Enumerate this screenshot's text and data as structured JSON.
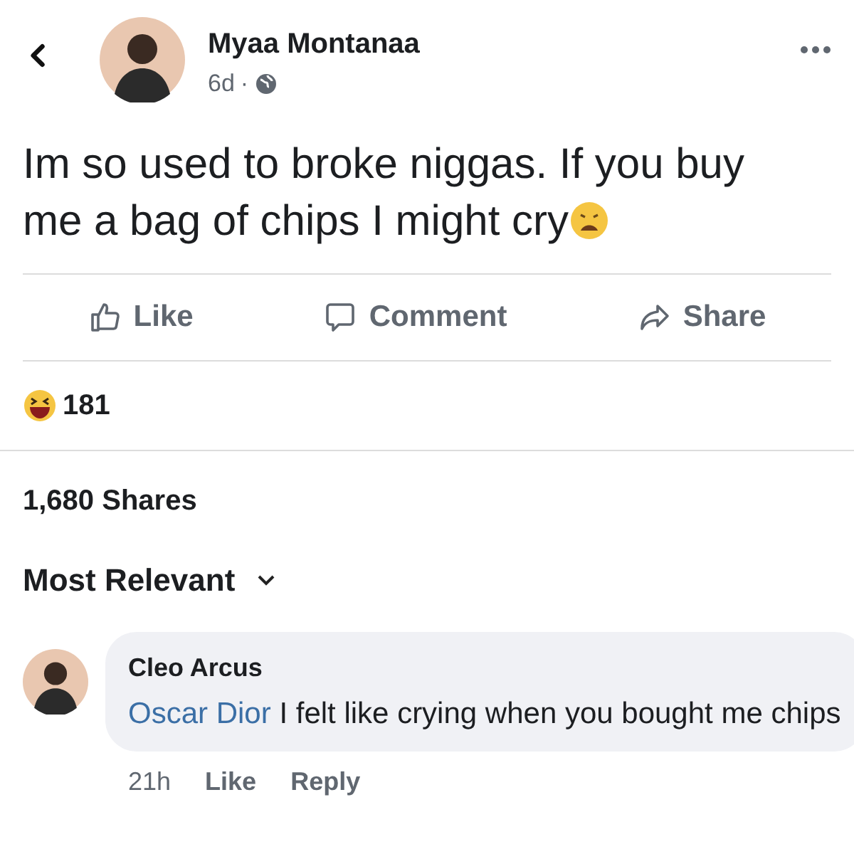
{
  "post": {
    "author": "Myaa Montanaa",
    "time": "6d",
    "separator": "·",
    "text": "Im so used to broke niggas. If you buy me a bag of chips I might cry"
  },
  "actions": [
    {
      "kind": "like",
      "label": "Like"
    },
    {
      "kind": "comment",
      "label": "Comment"
    },
    {
      "kind": "share",
      "label": "Share"
    }
  ],
  "reactions": {
    "count": "181"
  },
  "shares": "1,680 Shares",
  "sort": {
    "label": "Most Relevant"
  },
  "comments": [
    {
      "author": "Cleo Arcus",
      "mention": "Oscar Dior",
      "text": "I felt like crying when you bought me chips",
      "time": "21h",
      "actions": [
        "Like",
        "Reply"
      ]
    }
  ]
}
